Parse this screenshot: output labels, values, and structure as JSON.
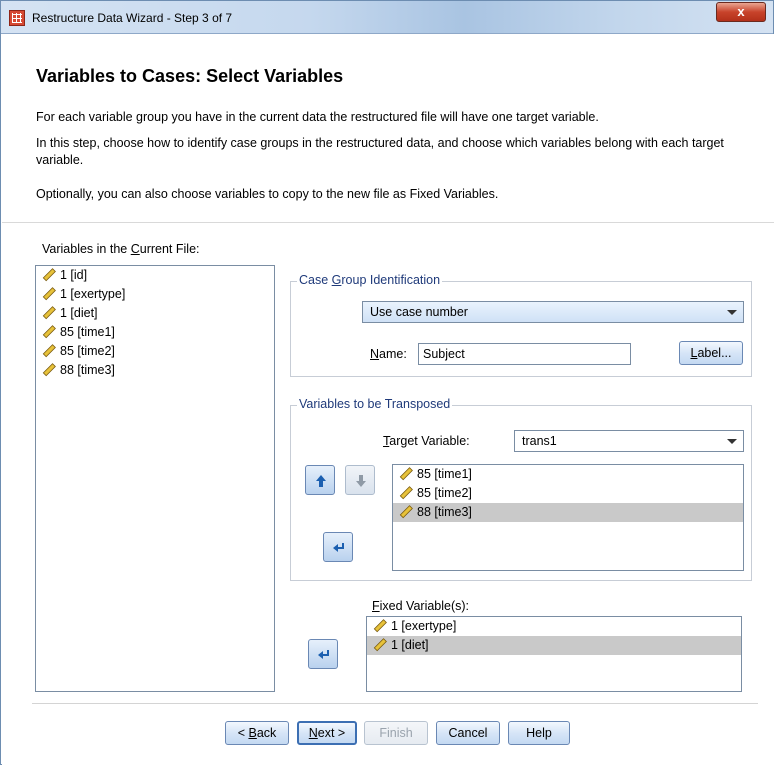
{
  "window": {
    "title": "Restructure Data Wizard - Step 3 of 7",
    "close_label": "x"
  },
  "header": {
    "page_title": "Variables to Cases: Select Variables",
    "para1": "For each variable group you have in the current data the restructured file will have one target variable.",
    "para2": "In this step, choose how to identify case groups in the restructured data, and choose which variables belong with each target variable.",
    "para3": "Optionally, you can also choose variables to copy to the new file as Fixed Variables."
  },
  "current_file": {
    "label_pre": "Variables in the ",
    "label_accel": "C",
    "label_post": "urrent File:",
    "items": [
      "1 [id]",
      "1 [exertype]",
      "1 [diet]",
      "85 [time1]",
      "85 [time2]",
      "88 [time3]"
    ]
  },
  "case_group": {
    "title_pre": "Case ",
    "title_accel": "G",
    "title_post": "roup Identification",
    "selected": "Use case number",
    "name_label_accel": "N",
    "name_label_post": "ame:",
    "name_value": "Subject",
    "label_button_accel": "L",
    "label_button_post": "abel..."
  },
  "transposed": {
    "title": "Variables to be Transposed",
    "target_label_accel": "T",
    "target_label_post": "arget Variable:",
    "target_value": "trans1",
    "items": [
      "85 [time1]",
      "85 [time2]",
      "88 [time3]"
    ],
    "selected_index": 2
  },
  "fixed": {
    "label_accel": "F",
    "label_post": "ixed Variable(s):",
    "items": [
      "1 [exertype]",
      "1 [diet]"
    ],
    "selected_index": 1
  },
  "footer": {
    "back_pre": "< ",
    "back_accel": "B",
    "back_post": "ack",
    "next_accel": "N",
    "next_post": "ext >",
    "finish": "Finish",
    "cancel": "Cancel",
    "help": "Help"
  },
  "icons": {
    "variable": "scale-ruler-icon",
    "move_up": "arrow-up-icon",
    "move_down": "arrow-down-icon",
    "move_into": "move-arrow-icon"
  },
  "colors": {
    "group_title": "#1f3a7a",
    "selection": "#c9c9c9",
    "button_border": "#6a88b4"
  }
}
